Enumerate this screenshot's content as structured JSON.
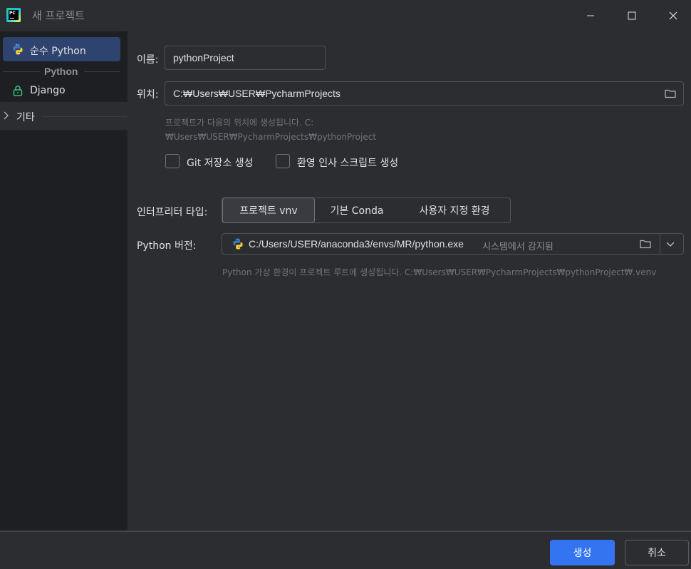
{
  "window": {
    "title": "새 프로젝트",
    "app_icon_text": "PC",
    "controls": [
      "minimize",
      "maximize",
      "close"
    ]
  },
  "sidebar": {
    "selected_item": {
      "label": "순수 Python",
      "icon": "python-icon"
    },
    "group_label": "Python",
    "items": [
      {
        "label": "Django",
        "icon": "lock-icon"
      }
    ],
    "other": {
      "label": "기타",
      "icon": "chevron-right-icon"
    }
  },
  "form": {
    "name_label": "이름:",
    "name_value": "pythonProject",
    "location_label": "위치:",
    "location_value": "C:₩Users₩USER₩PycharmProjects",
    "location_hint_1": "프로젝트가 다음의 위치에 생성됩니다. C:",
    "location_hint_2": "₩Users₩USER₩PycharmProjects₩pythonProject",
    "git_checkbox_label": "Git 저장소 생성",
    "welcome_checkbox_label": "환영 인사 스크립트 생성",
    "git_checked": false,
    "welcome_checked": false,
    "interpreter_type_label": "인터프리터 타입:",
    "interpreter_types": [
      "프로젝트 vnv",
      "기본 Conda",
      "사용자 지정 환경"
    ],
    "interpreter_selected": "프로젝트 vnv",
    "python_version_label": "Python 버전:",
    "python_path": "C:/Users/USER/anaconda3/envs/MR/python.exe",
    "python_detected": "시스템에서 감지됨",
    "venv_hint": "Python 가상 환경이 프로젝트 루트에 생성됩니다. C:₩Users₩USER₩PycharmProjects₩pythonProject₩.venv"
  },
  "footer": {
    "create_label": "생성",
    "cancel_label": "취소"
  },
  "colors": {
    "background": "#2b2d30",
    "sidebar": "#1e1f22",
    "selection": "#2e436e",
    "accent": "#3574f0",
    "text": "#dfe1e5",
    "hint": "#6f737a"
  }
}
